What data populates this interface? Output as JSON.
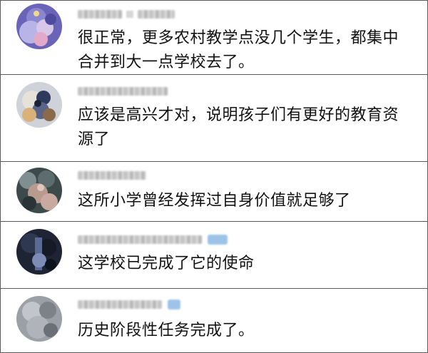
{
  "comments": [
    {
      "username": "LePetit · Prince",
      "text": "很正常，更多农村教学点没几个学生，都集中合并到大一点学校去了。"
    },
    {
      "username": "嗨店子的阿喵",
      "text": "应该是高兴才对，说明孩子们有更好的教育资源了"
    },
    {
      "username": "Mi2OB061",
      "text": "这所小学曾经发挥过自身价值就足够了"
    },
    {
      "username": "野雪生长的草原陈",
      "text": "这学校已完成了它的使命"
    },
    {
      "username": "蛋蛋哥123b",
      "text": "历史阶段性任务完成了。"
    }
  ]
}
